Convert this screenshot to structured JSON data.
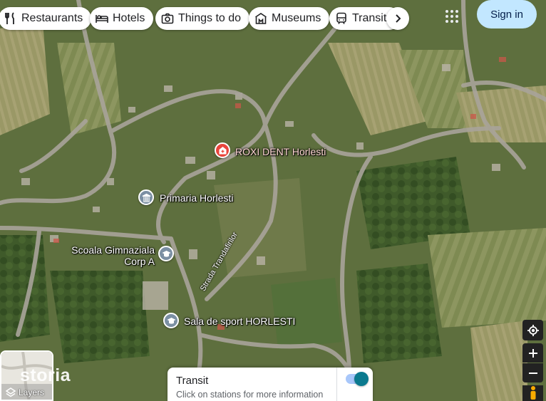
{
  "categories": [
    {
      "label": "Restaurants",
      "icon": "restaurant-icon"
    },
    {
      "label": "Hotels",
      "icon": "hotel-icon"
    },
    {
      "label": "Things to do",
      "icon": "camera-icon"
    },
    {
      "label": "Museums",
      "icon": "museum-icon"
    },
    {
      "label": "Transit",
      "icon": "transit-icon"
    }
  ],
  "header": {
    "sign_in_label": "Sign in"
  },
  "places": {
    "dentist": {
      "name": "ROXI DENT Horlesti",
      "icon": "medical-pin-icon",
      "color": "#e8453c"
    },
    "townhall": {
      "name": "Primaria Horlesti",
      "icon": "government-pin-icon",
      "color": "#7b8fa3"
    },
    "school_line1": "Scoala Gimnaziala",
    "school_line2": "Corp A",
    "school_icon": "school-pin-icon",
    "sports": {
      "name": "Sala de sport HORLESTI",
      "icon": "school-pin-icon"
    }
  },
  "streets": {
    "trandafirilor": "Strada Trandafirilor"
  },
  "layers": {
    "label": "Layers",
    "watermark": "storia"
  },
  "transit_panel": {
    "title": "Transit",
    "subtitle": "Click on stations for more information",
    "toggle_on": true
  },
  "colors": {
    "accent": "#c2e7ff",
    "toggle": "#0b7a8f",
    "poi_gray": "#7b8fa3",
    "poi_red": "#e8453c"
  }
}
